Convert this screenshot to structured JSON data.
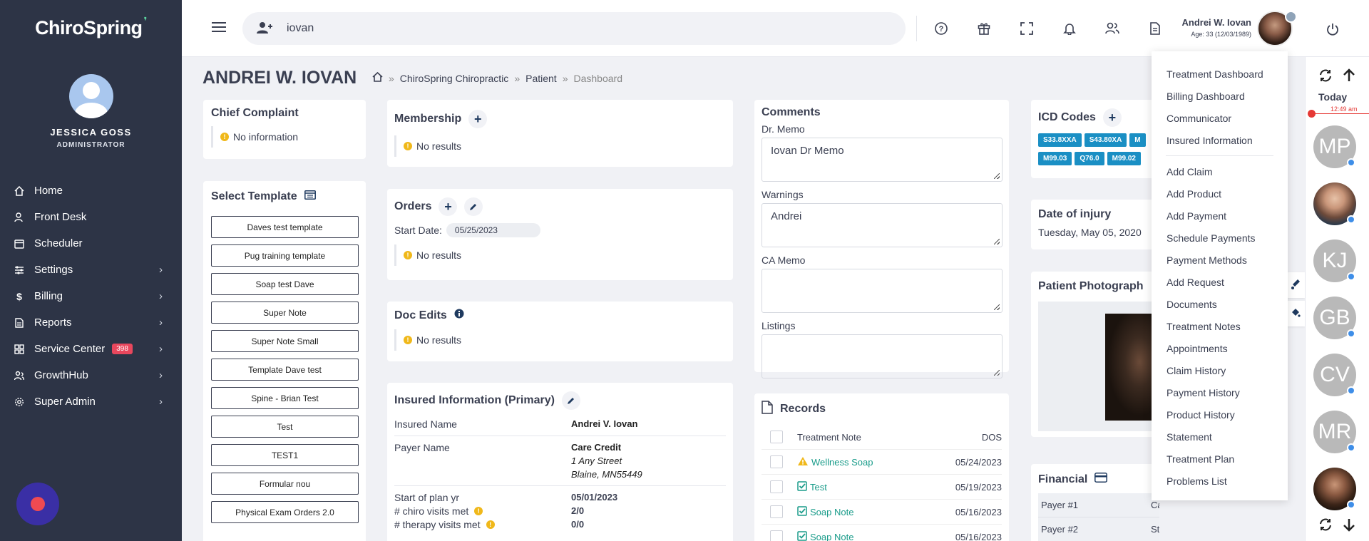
{
  "app": {
    "logo": "ChiroSpring"
  },
  "sidebar": {
    "user_name": "JESSICA GOSS",
    "user_role": "ADMINISTRATOR",
    "items": [
      {
        "label": "Home",
        "icon": "home-icon",
        "chevron": false
      },
      {
        "label": "Front Desk",
        "icon": "user-icon",
        "chevron": false
      },
      {
        "label": "Scheduler",
        "icon": "calendar-icon",
        "chevron": false
      },
      {
        "label": "Settings",
        "icon": "sliders-icon",
        "chevron": true
      },
      {
        "label": "Billing",
        "icon": "dollar-icon",
        "chevron": true
      },
      {
        "label": "Reports",
        "icon": "report-icon",
        "chevron": true
      },
      {
        "label": "Service Center",
        "icon": "grid-icon",
        "chevron": true,
        "badge": "398"
      },
      {
        "label": "GrowthHub",
        "icon": "growth-icon",
        "chevron": true
      },
      {
        "label": "Super Admin",
        "icon": "gear-icon",
        "chevron": true
      }
    ]
  },
  "topbar": {
    "search_value": "iovan",
    "user_name": "Andrei W. Iovan",
    "user_age": "Age: 33 (12/03/1989)"
  },
  "page": {
    "title": "ANDREI W. IOVAN",
    "breadcrumb": [
      "ChiroSpring Chiropractic",
      "Patient",
      "Dashboard"
    ]
  },
  "chief_complaint": {
    "title": "Chief Complaint",
    "text": "No information"
  },
  "select_template": {
    "title": "Select Template",
    "buttons": [
      "Daves test template",
      "Pug training template",
      "Soap test Dave",
      "Super Note",
      "Super Note Small",
      "Template Dave test",
      "Spine - Brian Test",
      "Test",
      "TEST1",
      "Formular nou",
      "Physical Exam Orders 2.0"
    ]
  },
  "membership": {
    "title": "Membership",
    "text": "No results"
  },
  "orders": {
    "title": "Orders",
    "start_label": "Start Date:",
    "start_value": "05/25/2023",
    "text": "No results"
  },
  "doc_edits": {
    "title": "Doc Edits",
    "text": "No results"
  },
  "insured": {
    "title": "Insured Information (Primary)",
    "insured_name_label": "Insured Name",
    "insured_name": "Andrei V. Iovan",
    "payer_label": "Payer Name",
    "payer_name": "Care Credit",
    "payer_addr1": "1 Any Street",
    "payer_addr2": "Blaine, MN55449",
    "plan_start_label": "Start of plan yr",
    "plan_start": "05/01/2023",
    "chiro_label": "# chiro visits met",
    "chiro_value": "2/0",
    "therapy_label": "# therapy visits met",
    "therapy_value": "0/0"
  },
  "comments": {
    "title": "Comments",
    "dr_memo_label": "Dr. Memo",
    "dr_memo": "Iovan Dr Memo",
    "warnings_label": "Warnings",
    "warnings": "Andrei",
    "ca_memo_label": "CA Memo",
    "ca_memo": "",
    "listings_label": "Listings",
    "listings": ""
  },
  "records": {
    "title": "Records",
    "col_note": "Treatment Note",
    "col_dos": "DOS",
    "rows": [
      {
        "name": "Wellness Soap",
        "date": "05/24/2023",
        "status": "warning"
      },
      {
        "name": "Test",
        "date": "05/19/2023",
        "status": "check"
      },
      {
        "name": "Soap Note",
        "date": "05/16/2023",
        "status": "check"
      },
      {
        "name": "Soap Note",
        "date": "05/16/2023",
        "status": "check"
      }
    ]
  },
  "icd": {
    "title": "ICD Codes",
    "codes": [
      "S33.8XXA",
      "S43.80XA",
      "M",
      "M99.03",
      "Q76.0",
      "M99.02"
    ]
  },
  "injury": {
    "title": "Date of injury",
    "value": "Tuesday, May 05, 2020"
  },
  "photo": {
    "title": "Patient Photograph"
  },
  "financial": {
    "title": "Financial",
    "rows": [
      {
        "label": "Payer #1",
        "value": "Care Credit"
      },
      {
        "label": "Payer #2",
        "value": "State Fund"
      }
    ]
  },
  "dropdown": {
    "group1": [
      "Treatment Dashboard",
      "Billing Dashboard",
      "Communicator",
      "Insured Information"
    ],
    "group2": [
      "Add Claim",
      "Add Product",
      "Add Payment",
      "Schedule Payments",
      "Payment Methods",
      "Add Request",
      "Documents",
      "Treatment Notes",
      "Appointments",
      "Claim History",
      "Payment History",
      "Product History",
      "Statement",
      "Treatment Plan",
      "Problems List"
    ]
  },
  "rail": {
    "today": "Today",
    "time": "12:49 am",
    "avatars": [
      {
        "initials": "MP",
        "photo": false
      },
      {
        "initials": "",
        "photo": true
      },
      {
        "initials": "KJ",
        "photo": false
      },
      {
        "initials": "GB",
        "photo": false
      },
      {
        "initials": "CV",
        "photo": false
      },
      {
        "initials": "MR",
        "photo": false
      },
      {
        "initials": "",
        "photo": true
      }
    ]
  }
}
